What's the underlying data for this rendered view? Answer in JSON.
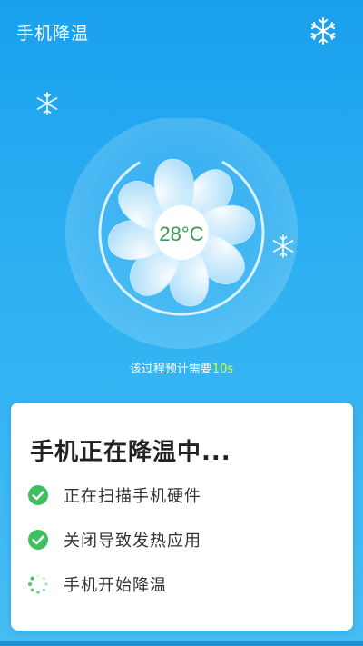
{
  "header": {
    "title": "手机降温",
    "right_icon": "snowflake-icon"
  },
  "fan": {
    "temperature": "28°C",
    "center_icon": "fan-icon"
  },
  "estimate": {
    "prefix": "该过程预计需要",
    "value": "10s"
  },
  "card": {
    "title": "手机正在降温中...",
    "steps": [
      {
        "label": "正在扫描手机硬件",
        "status": "done",
        "icon": "check-circle-icon"
      },
      {
        "label": "关闭导致发热应用",
        "status": "done",
        "icon": "check-circle-icon"
      },
      {
        "label": "手机开始降温",
        "status": "in-progress",
        "icon": "loading-spinner-icon"
      }
    ]
  },
  "colors": {
    "background": "#2fb1f2",
    "accent_green": "#3fbf5f",
    "temperature_green": "#3a9a55",
    "time_highlight": "#d8ff2f",
    "card_background": "#ffffff"
  }
}
